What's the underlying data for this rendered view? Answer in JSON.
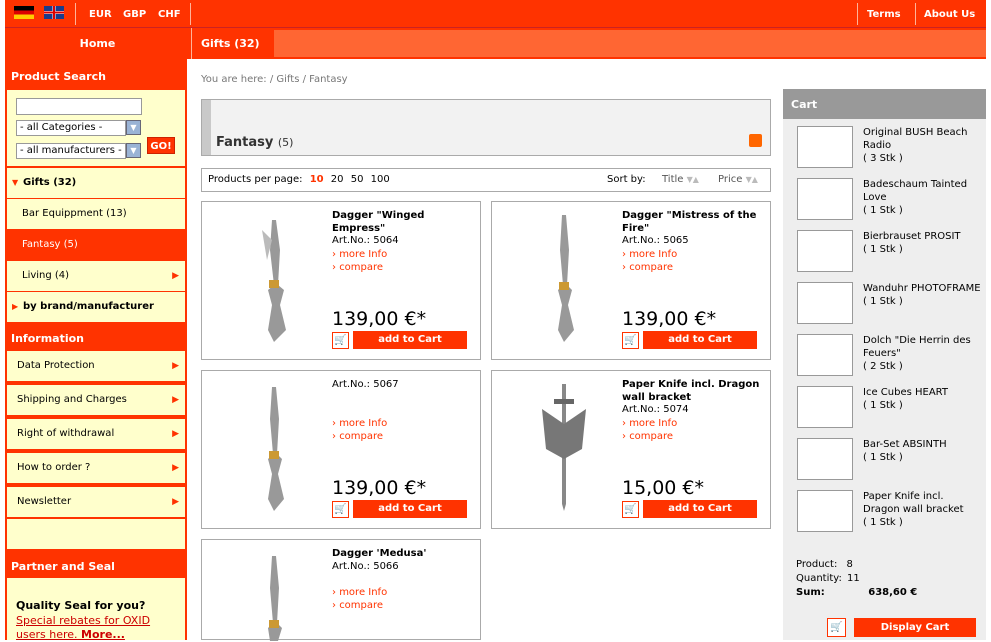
{
  "top": {
    "currencies": [
      "EUR",
      "GBP",
      "CHF"
    ],
    "terms": "Terms",
    "about": "About Us",
    "home": "Home",
    "gifts_tab": "Gifts (32)"
  },
  "sidebar": {
    "search_title": "Product Search",
    "search_value": "",
    "categories": "- all Categories -",
    "manufacturers": "- all manufacturers -",
    "go": "GO!",
    "items": [
      {
        "label": "Gifts (32)"
      },
      {
        "label": "Bar Equippment (13)"
      },
      {
        "label": "Fantasy (5)"
      },
      {
        "label": "Living (4)"
      },
      {
        "label": "by brand/manufacturer"
      }
    ],
    "info_title": "Information",
    "info": [
      "Data Protection",
      "Shipping and Charges",
      "Right of withdrawal",
      "How to order ?",
      "Newsletter"
    ],
    "partner_title": "Partner and Seal",
    "seal_title": "Quality Seal for you?",
    "seal_link": "Special rebates for OXID users here.",
    "seal_more": "More..."
  },
  "main": {
    "breadcrumb": "You are here: / Gifts / Fantasy",
    "category": "Fantasy",
    "count": "(5)",
    "per_page_label": "Products per page:",
    "pp": [
      "10",
      "20",
      "50",
      "100"
    ],
    "sort_label": "Sort by:",
    "sort_title": "Title",
    "sort_price": "Price",
    "more_info": "more Info",
    "compare": "compare",
    "add": "add to Cart",
    "products": [
      {
        "name": "Dagger \"Winged Empress\"",
        "art": "Art.No.: 5064",
        "price": "139,00 €*"
      },
      {
        "name": "Dagger \"Mistress of the Fire\"",
        "art": "Art.No.: 5065",
        "price": "139,00 €*"
      },
      {
        "name": "",
        "art": "Art.No.: 5067",
        "price": "139,00 €*"
      },
      {
        "name": "Paper Knife incl. Dragon wall bracket",
        "art": "Art.No.: 5074",
        "price": "15,00 €*"
      },
      {
        "name": "Dagger 'Medusa'",
        "art": "Art.No.: 5066",
        "price": ""
      }
    ]
  },
  "cart": {
    "title": "Cart",
    "items": [
      {
        "name": "Original BUSH Beach Radio",
        "qty": "( 3 Stk )"
      },
      {
        "name": "Badeschaum Tainted Love",
        "qty": "( 1 Stk )"
      },
      {
        "name": "Bierbrauset PROSIT",
        "qty": "( 1 Stk )"
      },
      {
        "name": "Wanduhr PHOTOFRAME",
        "qty": "( 1 Stk )"
      },
      {
        "name": "Dolch \"Die Herrin des Feuers\"",
        "qty": "( 2 Stk )"
      },
      {
        "name": "Ice Cubes HEART",
        "qty": "( 1 Stk )"
      },
      {
        "name": "Bar-Set ABSINTH",
        "qty": "( 1 Stk )"
      },
      {
        "name": "Paper Knife incl. Dragon wall bracket",
        "qty": "( 1 Stk )"
      }
    ],
    "product_label": "Product:",
    "product_val": "8",
    "qty_label": "Quantity:",
    "qty_val": "11",
    "sum_label": "Sum:",
    "sum_val": "638,60 €",
    "display": "Display Cart"
  },
  "colors": {
    "accent": "#ff3300",
    "sidebar_bg": "#ffffcc"
  }
}
